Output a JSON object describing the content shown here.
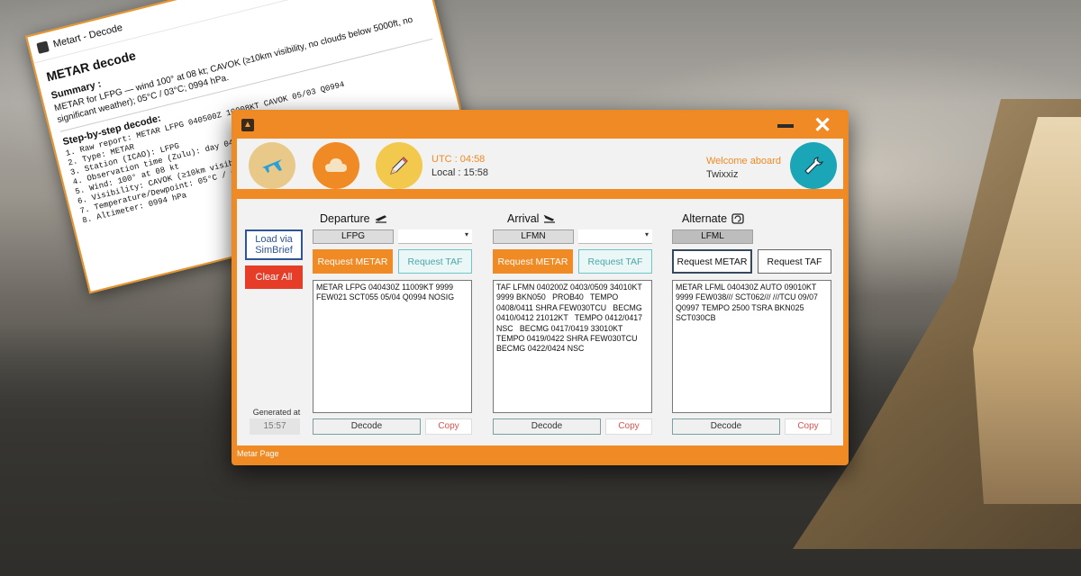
{
  "decode_window": {
    "title": "Metart - Decode",
    "heading": "METAR decode",
    "summary_label": "Summary :",
    "summary_text": "METAR for LFPG — wind 100° at 08 kt; CAVOK (≥10km visibility, no clouds below 5000ft, no significant weather); 05°C / 03°C; 0994 hPa.",
    "steps_label": "Step-by-step decode:",
    "steps": "1. Raw report: METAR LFPG 040500Z 10008KT CAVOK 05/03 Q0994\n2. Type: METAR\n3. Station (ICAO): LFPG\n4. Observation time (Zulu): day 04 at 05:00Z\n5. Wind: 100° at 08 kt\n6. Visibility: CAVOK (≥10km visibility, no significant weather)\n7. Temperature/Dewpoint: 05°C / 03°C\n8. Altimeter: 0994 hPa",
    "controls": {
      "minimize": "—",
      "maximize": "□",
      "close": "✕"
    }
  },
  "main_window": {
    "title_icon": "app-logo-icon",
    "minimize_glyph": "▬",
    "close_glyph": "✕",
    "header": {
      "utc": "UTC : 04:58",
      "local": "Local : 15:58",
      "welcome": "Welcome aboard",
      "username": "Twixxiz",
      "buttons": [
        {
          "icon": "plane-icon",
          "color": "#e8c98a"
        },
        {
          "icon": "cloud-icon",
          "color": "#f08a24"
        },
        {
          "icon": "pencil-icon",
          "color": "#f2c94c"
        },
        {
          "icon": "wrench-icon",
          "color": "#1aa6b7"
        }
      ]
    },
    "sidebar": {
      "load_label": "Load via SimBrief",
      "clear_label": "Clear All",
      "generated_label": "Generated at",
      "generated_time": "15:57"
    },
    "columns": [
      {
        "title": "Departure",
        "icao": "LFPG",
        "request_metar": "Request METAR",
        "request_taf": "Request TAF",
        "report": "METAR LFPG 040430Z 11009KT 9999 FEW021 SCT055 05/04 Q0994 NOSIG",
        "decode": "Decode",
        "copy": "Copy"
      },
      {
        "title": "Arrival",
        "icao": "LFMN",
        "request_metar": "Request METAR",
        "request_taf": "Request TAF",
        "report": "TAF LFMN 040200Z 0403/0509 34010KT 9999 BKN050   PROB40   TEMPO 0408/0411 SHRA FEW030TCU   BECMG 0410/0412 21012KT   TEMPO 0412/0417 NSC   BECMG 0417/0419 33010KT   TEMPO 0419/0422 SHRA FEW030TCU BECMG 0422/0424 NSC",
        "decode": "Decode",
        "copy": "Copy"
      },
      {
        "title": "Alternate",
        "icao": "LFML",
        "request_metar": "Request METAR",
        "request_taf": "Request TAF",
        "report": "METAR LFML 040430Z AUTO 09010KT 9999 FEW038/// SCT062/// ///TCU 09/07 Q0997 TEMPO 2500 TSRA BKN025 SCT030CB",
        "decode": "Decode",
        "copy": "Copy"
      }
    ],
    "status": "Metar Page"
  },
  "colors": {
    "accent": "#f08a24",
    "panel": "#f2f2f2",
    "danger": "#e53d28",
    "teal": "#6ec6c6",
    "navy": "#2f5597"
  }
}
